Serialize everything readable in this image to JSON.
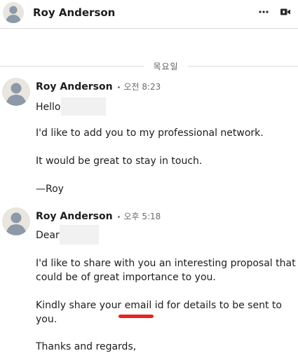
{
  "header": {
    "name": "Roy Anderson",
    "more_icon": "more-horizontal-icon",
    "video_icon": "video-call-icon"
  },
  "divider": {
    "label": "목요일"
  },
  "messages": [
    {
      "sender": "Roy Anderson",
      "separator": "•",
      "time": "오전 8:23",
      "lines": [
        "Hello",
        "I'd like to add you to my professional network.",
        "It would be great to stay in touch.",
        "—Roy"
      ]
    },
    {
      "sender": "Roy Anderson",
      "separator": "•",
      "time": "오후 5:18",
      "lines": [
        "Dear",
        "I'd like to share with you an interesting proposal that",
        "could be of great importance to you.",
        "Kindly share your email id for details to be sent to",
        "you.",
        "Thanks and regards,"
      ]
    }
  ],
  "colors": {
    "avatar_bg": "#e9e5df",
    "avatar_figure": "#8b99a8",
    "annotation_underline": "#ee1f1f",
    "divider": "#dcdcdc"
  }
}
